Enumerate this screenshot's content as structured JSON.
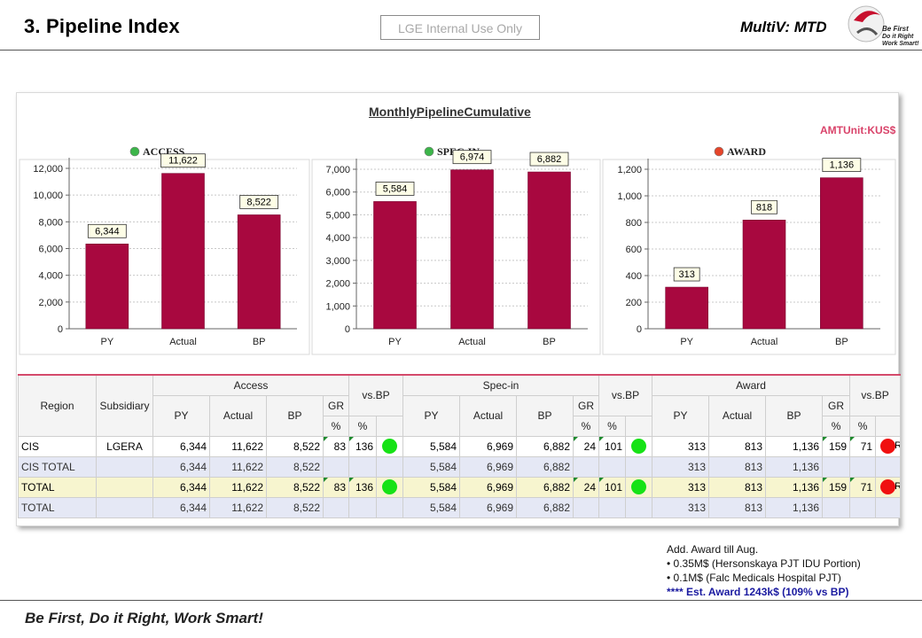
{
  "header": {
    "title": "3. Pipeline Index",
    "confidential": "LGE Internal Use Only",
    "product": "MultiV: MTD",
    "logo_text": [
      "Be First",
      "Do it Right",
      "Work Smart!"
    ]
  },
  "dashboard": {
    "title": "MonthlyPipelineCumulative",
    "unit": "AMTUnit:KUS$"
  },
  "chart_data": [
    {
      "type": "bar",
      "title": "ACCESS",
      "status_color": "#3cb54a",
      "categories": [
        "PY",
        "Actual",
        "BP"
      ],
      "values": [
        6344,
        11622,
        8522
      ],
      "value_labels": [
        "6,344",
        "11,622",
        "8,522"
      ],
      "ylim": [
        0,
        12000
      ],
      "yticks": [
        0,
        2000,
        4000,
        6000,
        8000,
        10000,
        12000
      ],
      "ytick_labels": [
        "0",
        "2,000",
        "4,000",
        "6,000",
        "8,000",
        "10,000",
        "12,000"
      ],
      "bar_color": "#a8083f"
    },
    {
      "type": "bar",
      "title": "SPEC-IN",
      "status_color": "#3cb54a",
      "categories": [
        "PY",
        "Actual",
        "BP"
      ],
      "values": [
        5584,
        6974,
        6882
      ],
      "value_labels": [
        "5,584",
        "6,974",
        "6,882"
      ],
      "ylim": [
        0,
        7000
      ],
      "yticks": [
        0,
        1000,
        2000,
        3000,
        4000,
        5000,
        6000,
        7000
      ],
      "ytick_labels": [
        "0",
        "1,000",
        "2,000",
        "3,000",
        "4,000",
        "5,000",
        "6,000",
        "7,000"
      ],
      "bar_color": "#a8083f"
    },
    {
      "type": "bar",
      "title": "AWARD",
      "status_color": "#e5452a",
      "categories": [
        "PY",
        "Actual",
        "BP"
      ],
      "values": [
        313,
        818,
        1136
      ],
      "value_labels": [
        "313",
        "818",
        "1,136"
      ],
      "ylim": [
        0,
        1200
      ],
      "yticks": [
        0,
        200,
        400,
        600,
        800,
        1000,
        1200
      ],
      "ytick_labels": [
        "0",
        "200",
        "400",
        "600",
        "800",
        "1,000",
        "1,200"
      ],
      "bar_color": "#a8083f"
    }
  ],
  "table": {
    "headers": {
      "region": "Region",
      "subsidiary": "Subsidiary",
      "groups": [
        "Access",
        "Spec-in",
        "Award"
      ],
      "vsbp": "vs.BP",
      "py": "PY",
      "actual": "Actual",
      "bp": "BP",
      "gr": "GR",
      "pct": "%"
    },
    "rows": [
      {
        "region": "CIS",
        "subsidiary": "LGERA",
        "a_py": "6,344",
        "a_act": "11,622",
        "a_bp": "8,522",
        "a_gr": "83",
        "a_vs": "136",
        "a_stat": "green",
        "s_py": "5,584",
        "s_act": "6,969",
        "s_bp": "6,882",
        "s_gr": "24",
        "s_vs": "101",
        "s_stat": "green",
        "w_py": "313",
        "w_act": "813",
        "w_bp": "1,136",
        "w_gr": "159",
        "w_vs": "71",
        "w_stat": "red",
        "w_r": "R"
      },
      {
        "region": "CIS TOTAL",
        "subsidiary": "",
        "a_py": "6,344",
        "a_act": "11,622",
        "a_bp": "8,522",
        "a_gr": "",
        "a_vs": "",
        "a_stat": "",
        "s_py": "5,584",
        "s_act": "6,969",
        "s_bp": "6,882",
        "s_gr": "",
        "s_vs": "",
        "s_stat": "",
        "w_py": "313",
        "w_act": "813",
        "w_bp": "1,136",
        "w_gr": "",
        "w_vs": "",
        "w_stat": "",
        "w_r": ""
      },
      {
        "region": "TOTAL",
        "subsidiary": "",
        "a_py": "6,344",
        "a_act": "11,622",
        "a_bp": "8,522",
        "a_gr": "83",
        "a_vs": "136",
        "a_stat": "green",
        "s_py": "5,584",
        "s_act": "6,969",
        "s_bp": "6,882",
        "s_gr": "24",
        "s_vs": "101",
        "s_stat": "green",
        "w_py": "313",
        "w_act": "813",
        "w_bp": "1,136",
        "w_gr": "159",
        "w_vs": "71",
        "w_stat": "red",
        "w_r": "R"
      },
      {
        "region": "TOTAL",
        "subsidiary": "",
        "a_py": "6,344",
        "a_act": "11,622",
        "a_bp": "8,522",
        "a_gr": "",
        "a_vs": "",
        "a_stat": "",
        "s_py": "5,584",
        "s_act": "6,969",
        "s_bp": "6,882",
        "s_gr": "",
        "s_vs": "",
        "s_stat": "",
        "w_py": "313",
        "w_act": "813",
        "w_bp": "1,136",
        "w_gr": "",
        "w_vs": "",
        "w_stat": "",
        "w_r": ""
      }
    ]
  },
  "notes": {
    "line1": "Add. Award till Aug.",
    "line2": "• 0.35M$ (Hersonskaya PJT IDU Portion)",
    "line3": "• 0.1M$ (Falc Medicals Hospital PJT)",
    "line4": "**** Est. Award  1243k$ (109%  vs  BP)"
  },
  "footer": {
    "slogan": "Be First, Do it Right, Work Smart!"
  }
}
